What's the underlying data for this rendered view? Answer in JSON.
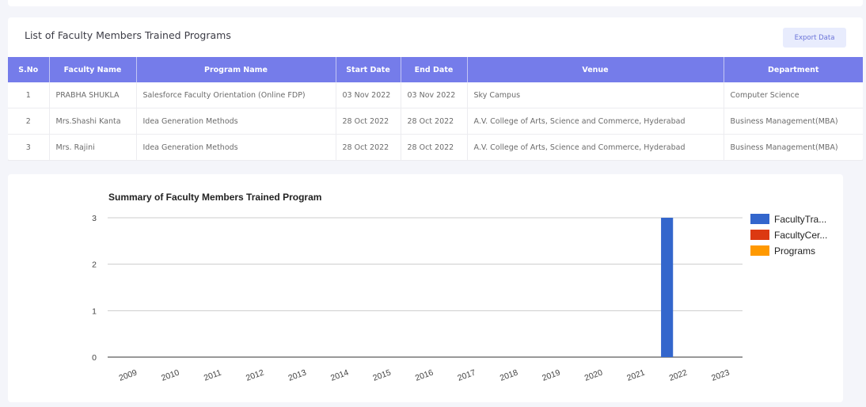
{
  "table": {
    "title": "List of Faculty Members Trained Programs",
    "export_label": "Export Data",
    "columns": [
      "S.No",
      "Faculty Name",
      "Program Name",
      "Start Date",
      "End Date",
      "Venue",
      "Department"
    ],
    "rows": [
      [
        "1",
        "PRABHA SHUKLA",
        "Salesforce Faculty Orientation (Online FDP)",
        "03 Nov 2022",
        "03 Nov 2022",
        "Sky Campus",
        "Computer Science"
      ],
      [
        "2",
        "Mrs.Shashi Kanta",
        "Idea Generation Methods",
        "28 Oct 2022",
        "28 Oct 2022",
        "A.V. College of Arts, Science and Commerce, Hyderabad",
        "Business Management(MBA)"
      ],
      [
        "3",
        "Mrs. Rajini",
        "Idea Generation Methods",
        "28 Oct 2022",
        "28 Oct 2022",
        "A.V. College of Arts, Science and Commerce, Hyderabad",
        "Business Management(MBA)"
      ]
    ]
  },
  "chart_data": {
    "type": "bar",
    "title": "Summary of Faculty Members Trained Program",
    "xlabel": "",
    "ylabel": "",
    "categories": [
      "2009",
      "2010",
      "2011",
      "2012",
      "2013",
      "2014",
      "2015",
      "2016",
      "2017",
      "2018",
      "2019",
      "2020",
      "2021",
      "2022",
      "2023"
    ],
    "ylim": [
      0,
      3
    ],
    "yticks": [
      0,
      1,
      2,
      3
    ],
    "grid": true,
    "legend_position": "right",
    "series": [
      {
        "name": "FacultyTra...",
        "color": "#3366cc",
        "values": [
          0,
          0,
          0,
          0,
          0,
          0,
          0,
          0,
          0,
          0,
          0,
          0,
          0,
          3,
          0
        ]
      },
      {
        "name": "FacultyCer...",
        "color": "#dc3912",
        "values": [
          0,
          0,
          0,
          0,
          0,
          0,
          0,
          0,
          0,
          0,
          0,
          0,
          0,
          0,
          0
        ]
      },
      {
        "name": "Programs",
        "color": "#ff9900",
        "values": [
          0,
          0,
          0,
          0,
          0,
          0,
          0,
          0,
          0,
          0,
          0,
          0,
          0,
          0,
          0
        ]
      }
    ]
  }
}
